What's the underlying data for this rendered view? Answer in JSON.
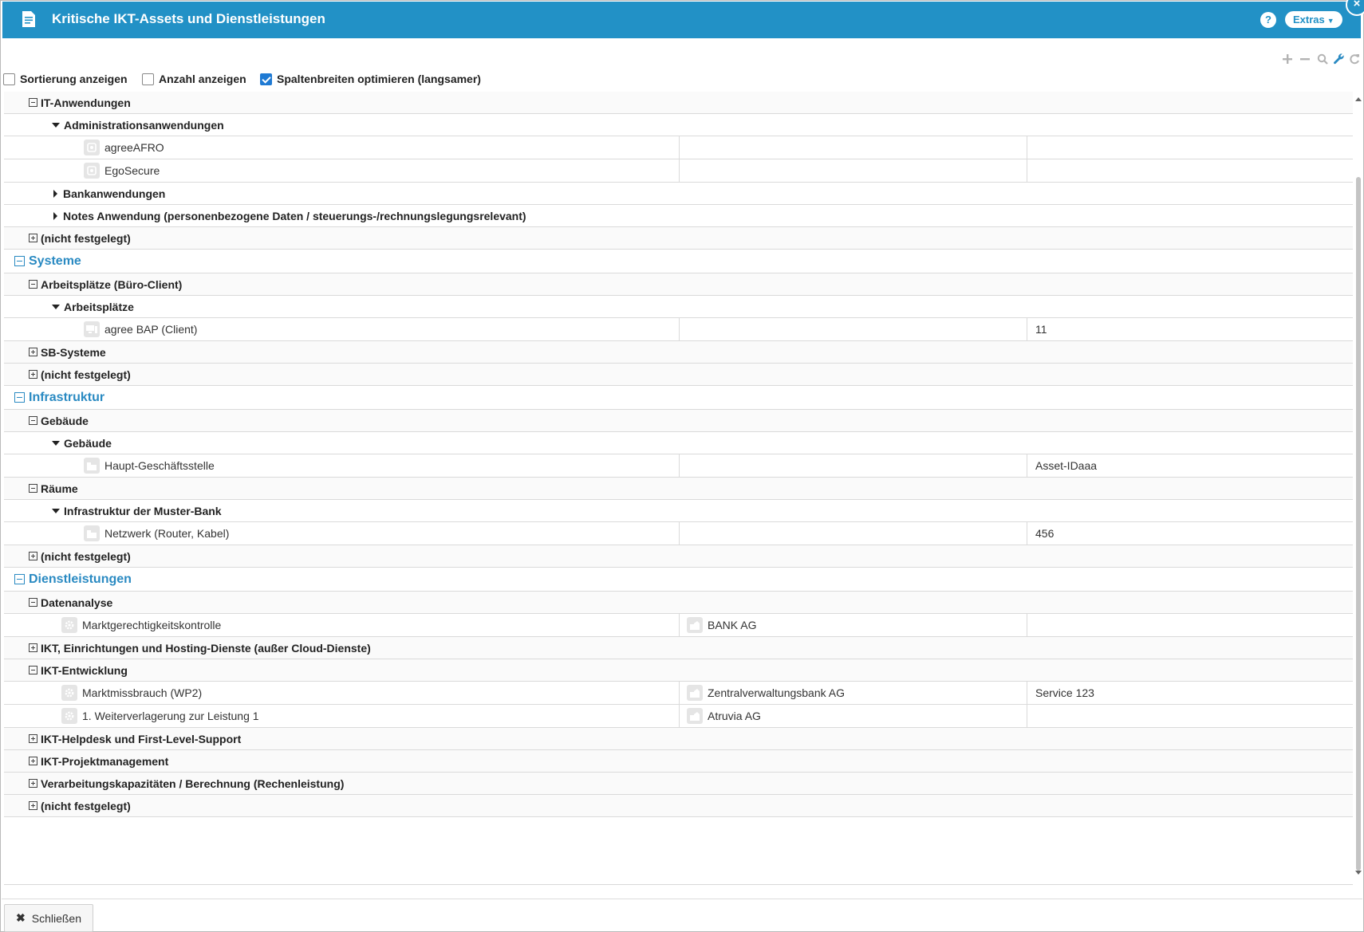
{
  "title": "Kritische IKT-Assets und Dienstleistungen",
  "help_label": "?",
  "extras_label": "Extras",
  "close_x_label": "×",
  "toolbar": {
    "icons": [
      "plus-icon",
      "minus-icon",
      "search-icon",
      "wrench-icon",
      "refresh-icon"
    ]
  },
  "options": {
    "sort": {
      "label": "Sortierung anzeigen",
      "checked": false
    },
    "count": {
      "label": "Anzahl anzeigen",
      "checked": false
    },
    "optimize": {
      "label": "Spaltenbreiten optimieren (langsamer)",
      "checked": true
    }
  },
  "rows": [
    {
      "type": "g2",
      "label": "IT-Anwendungen",
      "toggle": "minus"
    },
    {
      "type": "g3",
      "label": "Administrationsanwendungen",
      "toggle": "down"
    },
    {
      "type": "item",
      "label": "agreeAFRO",
      "icon": "app-icon",
      "col2": "",
      "col3": ""
    },
    {
      "type": "item",
      "label": "EgoSecure",
      "icon": "app-icon",
      "col2": "",
      "col3": ""
    },
    {
      "type": "g3",
      "label": "Bankanwendungen",
      "toggle": "right"
    },
    {
      "type": "g3",
      "label": "Notes Anwendung (personenbezogene Daten / steuerungs-/rechnungslegungsrelevant)",
      "toggle": "right"
    },
    {
      "type": "g2",
      "label": "(nicht festgelegt)",
      "toggle": "plus"
    },
    {
      "type": "g1",
      "label": "Systeme",
      "toggle": "minus"
    },
    {
      "type": "g2",
      "label": "Arbeitsplätze (Büro-Client)",
      "toggle": "minus"
    },
    {
      "type": "g3",
      "label": "Arbeitsplätze",
      "toggle": "down"
    },
    {
      "type": "item",
      "label": "agree BAP (Client)",
      "icon": "computer-icon",
      "col2": "",
      "col3": "11"
    },
    {
      "type": "g2",
      "label": "SB-Systeme",
      "toggle": "plus"
    },
    {
      "type": "g2",
      "label": "(nicht festgelegt)",
      "toggle": "plus"
    },
    {
      "type": "g1",
      "label": "Infrastruktur",
      "toggle": "minus"
    },
    {
      "type": "g2",
      "label": "Gebäude",
      "toggle": "minus"
    },
    {
      "type": "g3",
      "label": "Gebäude",
      "toggle": "down"
    },
    {
      "type": "item",
      "label": "Haupt-Geschäftsstelle",
      "icon": "building-icon",
      "col2": "",
      "col3": "Asset-IDaaa"
    },
    {
      "type": "g2",
      "label": "Räume",
      "toggle": "minus"
    },
    {
      "type": "g3",
      "label": "Infrastruktur der Muster-Bank",
      "toggle": "down"
    },
    {
      "type": "item",
      "label": "Netzwerk (Router, Kabel)",
      "icon": "building-icon",
      "col2": "",
      "col3": "456"
    },
    {
      "type": "g2",
      "label": "(nicht festgelegt)",
      "toggle": "plus"
    },
    {
      "type": "g1",
      "label": "Dienstleistungen",
      "toggle": "minus"
    },
    {
      "type": "g2",
      "label": "Datenanalyse",
      "toggle": "minus"
    },
    {
      "type": "item",
      "label": "Marktgerechtigkeitskontrolle",
      "icon": "gear-icon",
      "col2": "BANK AG",
      "col2icon": "company-icon",
      "col3": ""
    },
    {
      "type": "g2",
      "label": "IKT, Einrichtungen und Hosting-Dienste (außer Cloud-Dienste)",
      "toggle": "plus"
    },
    {
      "type": "g2",
      "label": "IKT-Entwicklung",
      "toggle": "minus"
    },
    {
      "type": "item",
      "label": "Marktmissbrauch (WP2)",
      "icon": "gear-icon",
      "col2": "Zentralverwaltungsbank AG",
      "col2icon": "company-icon",
      "col3": "Service 123"
    },
    {
      "type": "item",
      "label": "1. Weiterverlagerung zur Leistung 1",
      "icon": "gear-icon",
      "col2": "Atruvia AG",
      "col2icon": "company-icon",
      "col3": ""
    },
    {
      "type": "g2",
      "label": "IKT-Helpdesk und First-Level-Support",
      "toggle": "plus"
    },
    {
      "type": "g2",
      "label": "IKT-Projektmanagement",
      "toggle": "plus"
    },
    {
      "type": "g2",
      "label": "Verarbeitungskapazitäten / Berechnung (Rechenleistung)",
      "toggle": "plus"
    },
    {
      "type": "g2",
      "label": "(nicht festgelegt)",
      "toggle": "plus"
    }
  ],
  "close_button_label": "Schließen"
}
